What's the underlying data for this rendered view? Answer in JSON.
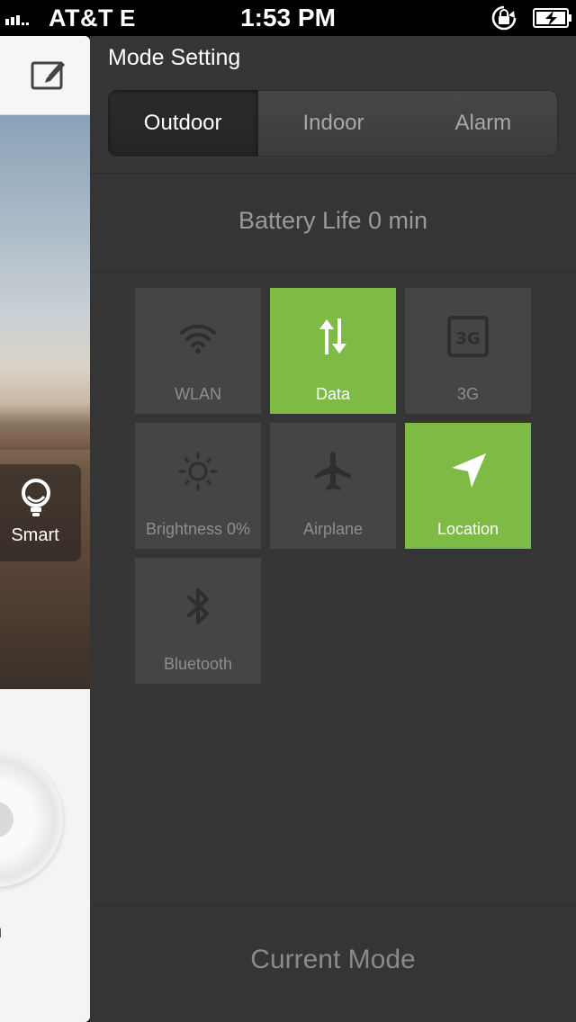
{
  "status_bar": {
    "carrier": "AT&T",
    "network": "E",
    "time": "1:53 PM"
  },
  "left_page": {
    "smart_label": "Smart",
    "bottom_label_fragment": "m"
  },
  "panel": {
    "title": "Mode Setting",
    "tabs": [
      {
        "label": "Outdoor",
        "active": true
      },
      {
        "label": "Indoor",
        "active": false
      },
      {
        "label": "Alarm",
        "active": false
      }
    ],
    "battery_life": "Battery Life 0 min",
    "tiles": [
      {
        "label": "WLAN",
        "icon": "wifi-icon",
        "on": false
      },
      {
        "label": "Data",
        "icon": "data-arrows-icon",
        "on": true
      },
      {
        "label": "3G",
        "icon": "3g-icon",
        "on": false
      },
      {
        "label": "Brightness 0%",
        "icon": "brightness-icon",
        "on": false
      },
      {
        "label": "Airplane",
        "icon": "airplane-icon",
        "on": false
      },
      {
        "label": "Location",
        "icon": "location-icon",
        "on": true
      },
      {
        "label": "Bluetooth",
        "icon": "bluetooth-icon",
        "on": false
      }
    ],
    "current_mode": "Current Mode"
  },
  "colors": {
    "accent_green": "#7dbb45",
    "panel_bg": "#353535",
    "tile_bg": "#454545"
  }
}
